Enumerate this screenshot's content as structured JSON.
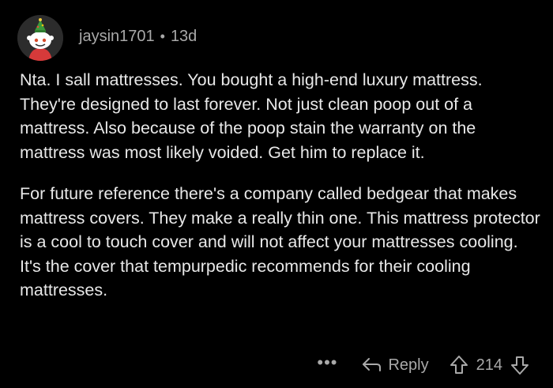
{
  "comment": {
    "username": "jaysin1701",
    "separator": "•",
    "age": "13d",
    "paragraphs": [
      "Nta. I sall mattresses. You bought a high-end luxury mattress. They're designed to last forever. Not just clean poop out of a mattress. Also because of the poop stain the warranty on the mattress was most likely voided.  Get him to replace it.",
      "For future reference there's a company called bedgear that makes mattress covers. They make a really thin one. This mattress protector is a cool to touch cover and will not affect your mattresses cooling. It's the cover that tempurpedic recommends for their cooling mattresses."
    ],
    "actions": {
      "more": "•••",
      "reply": "Reply",
      "score": "214"
    }
  },
  "colors": {
    "background": "#000000",
    "text": "#e8e8e8",
    "muted": "#a9a9a9"
  },
  "icons": [
    "avatar-snoo-icon",
    "reply-arrow-icon",
    "upvote-icon",
    "downvote-icon"
  ]
}
